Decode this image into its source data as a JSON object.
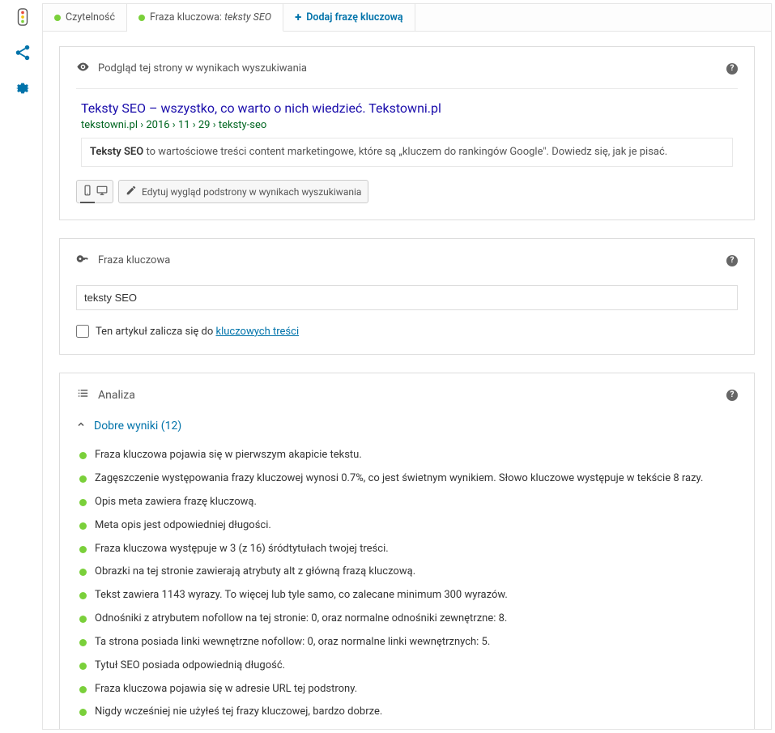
{
  "sidebar": {
    "icons": [
      "traffic-light-icon",
      "share-icon",
      "gear-icon"
    ]
  },
  "tabs": {
    "readability": "Czytelność",
    "keyword_label": "Fraza kluczowa:",
    "keyword_value": "teksty SEO",
    "add": "Dodaj frazę kluczową"
  },
  "preview": {
    "heading": "Podgląd tej strony w wynikach wyszukiwania",
    "title": "Teksty SEO – wszystko, co warto o nich wiedzieć. Tekstowni.pl",
    "url": "tekstowni.pl › 2016 › 11 › 29 › teksty-seo",
    "desc_bold": "Teksty SEO",
    "desc_rest": " to wartościowe treści content marketingowe, które są „kluczem do rankingów Google\". Dowiedz się, jak je pisać.",
    "edit_btn": "Edytuj wygląd podstrony w wynikach wyszukiwania"
  },
  "keyword": {
    "heading": "Fraza kluczowa",
    "value": "teksty SEO",
    "checkbox_prefix": "Ten artykuł zalicza się do ",
    "checkbox_link": "kluczowych treści"
  },
  "analysis": {
    "heading": "Analiza",
    "good_label": "Dobre wyniki (12)",
    "items": [
      "Fraza kluczowa pojawia się w pierwszym akapicie tekstu.",
      "Zagęszczenie występowania frazy kluczowej wynosi 0.7%, co jest świetnym wynikiem. Słowo kluczowe występuje w tekście 8 razy.",
      "Opis meta zawiera frazę kluczową.",
      "Meta opis jest odpowiedniej długości.",
      "Fraza kluczowa występuje w 3 (z 16) śródtytułach twojej treści.",
      "Obrazki na tej stronie zawierają atrybuty alt z główną frazą kluczową.",
      "Tekst zawiera 1143 wyrazy. To więcej lub tyle samo, co zalecane minimum 300 wyrazów.",
      "Odnośniki z atrybutem nofollow na tej stronie: 0, oraz normalne odnośniki zewnętrzne: 8.",
      "Ta strona posiada linki wewnętrzne nofollow: 0, oraz normalne linki wewnętrznych: 5.",
      "Tytuł SEO posiada odpowiednią długość.",
      "Fraza kluczowa pojawia się w adresie URL tej podstrony.",
      "Nigdy wcześniej nie użyłeś tej frazy kluczowej, bardzo dobrze."
    ]
  }
}
